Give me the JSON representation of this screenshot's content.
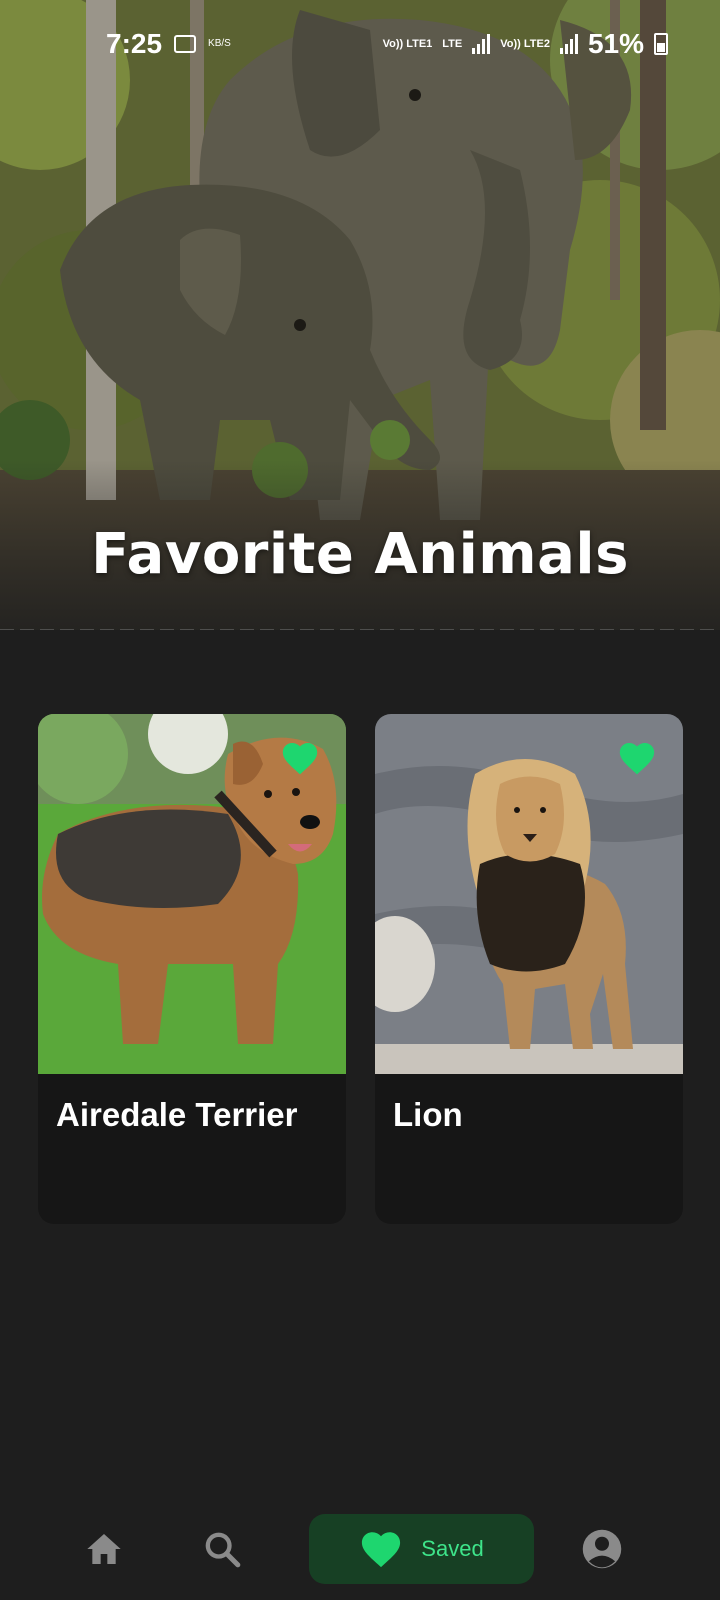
{
  "status_bar": {
    "time": "7:25",
    "speed_unit": "KB/S",
    "sim1_label": "Vo)) LTE1",
    "lte_label": "LTE",
    "sim2_label": "Vo)) LTE2",
    "battery": "51%"
  },
  "header": {
    "title": "Favorite Animals",
    "image": "elephants-photo"
  },
  "cards": [
    {
      "name": "Airedale Terrier",
      "image": "airedale-terrier-photo",
      "favorite": true
    },
    {
      "name": "Lion",
      "image": "lion-photo",
      "favorite": true
    }
  ],
  "bottom_nav": {
    "items": [
      {
        "icon": "home-icon",
        "label": ""
      },
      {
        "icon": "search-icon",
        "label": ""
      },
      {
        "icon": "heart-icon",
        "label": "Saved",
        "active": true
      },
      {
        "icon": "profile-icon",
        "label": ""
      }
    ]
  },
  "colors": {
    "background": "#1e1e1e",
    "card": "#161616",
    "accent": "#1ed66f",
    "active_pill": "#174024",
    "nav_icon": "#8a8a8a"
  }
}
